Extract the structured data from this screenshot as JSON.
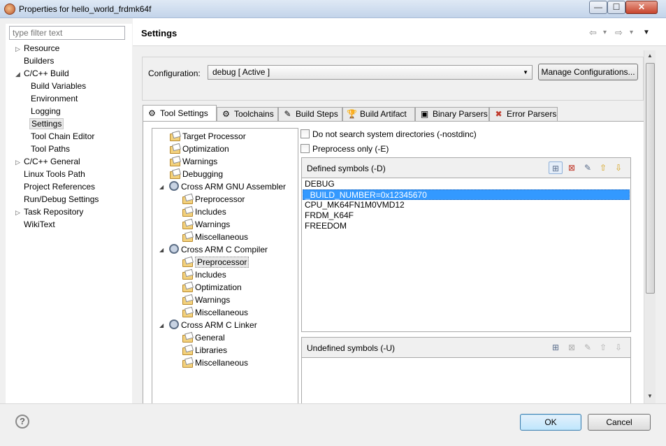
{
  "window": {
    "title": "Properties for hello_world_frdmk64f",
    "min_label": "—",
    "max_label": "☐",
    "close_label": "✕"
  },
  "sidebar": {
    "filter_placeholder": "type filter text",
    "items": [
      {
        "label": "Resource",
        "arrow": "▷"
      },
      {
        "label": "Builders",
        "arrow": ""
      },
      {
        "label": "C/C++ Build",
        "arrow": "◢"
      },
      {
        "label": "Build Variables",
        "arrow": ""
      },
      {
        "label": "Environment",
        "arrow": ""
      },
      {
        "label": "Logging",
        "arrow": ""
      },
      {
        "label": "Settings",
        "arrow": ""
      },
      {
        "label": "Tool Chain Editor",
        "arrow": ""
      },
      {
        "label": "Tool Paths",
        "arrow": ""
      },
      {
        "label": "C/C++ General",
        "arrow": "▷"
      },
      {
        "label": "Linux Tools Path",
        "arrow": ""
      },
      {
        "label": "Project References",
        "arrow": ""
      },
      {
        "label": "Run/Debug Settings",
        "arrow": ""
      },
      {
        "label": "Task Repository",
        "arrow": "▷"
      },
      {
        "label": "WikiText",
        "arrow": ""
      }
    ]
  },
  "header": {
    "title": "Settings",
    "back_icon": "⇦",
    "forward_icon": "⇨",
    "dropdown_icon": "▾",
    "menu_icon": "▼"
  },
  "configuration": {
    "label": "Configuration:",
    "value": "debug  [ Active ]",
    "manage_label": "Manage Configurations..."
  },
  "tabs": [
    {
      "label": "Tool Settings",
      "icon": "⚙"
    },
    {
      "label": "Toolchains",
      "icon": "⚙"
    },
    {
      "label": "Build Steps",
      "icon": "✎"
    },
    {
      "label": "Build Artifact",
      "icon": "🏆"
    },
    {
      "label": "Binary Parsers",
      "icon": "▣"
    },
    {
      "label": "Error Parsers",
      "icon": "✖"
    }
  ],
  "tool_tree": [
    {
      "label": "Target Processor",
      "icon": "folder"
    },
    {
      "label": "Optimization",
      "icon": "folder"
    },
    {
      "label": "Warnings",
      "icon": "folder"
    },
    {
      "label": "Debugging",
      "icon": "folder"
    },
    {
      "label": "Cross ARM GNU Assembler",
      "icon": "gear"
    },
    {
      "label": "Preprocessor",
      "icon": "folder"
    },
    {
      "label": "Includes",
      "icon": "folder"
    },
    {
      "label": "Warnings",
      "icon": "folder"
    },
    {
      "label": "Miscellaneous",
      "icon": "folder"
    },
    {
      "label": "Cross ARM C Compiler",
      "icon": "gear"
    },
    {
      "label": "Preprocessor",
      "icon": "folder"
    },
    {
      "label": "Includes",
      "icon": "folder"
    },
    {
      "label": "Optimization",
      "icon": "folder"
    },
    {
      "label": "Warnings",
      "icon": "folder"
    },
    {
      "label": "Miscellaneous",
      "icon": "folder"
    },
    {
      "label": "Cross ARM C Linker",
      "icon": "gear"
    },
    {
      "label": "General",
      "icon": "folder"
    },
    {
      "label": "Libraries",
      "icon": "folder"
    },
    {
      "label": "Miscellaneous",
      "icon": "folder"
    }
  ],
  "options": {
    "nostdinc_label": "Do not search system directories (-nostdinc)",
    "preprocess_label": "Preprocess only (-E)"
  },
  "defined_symbols": {
    "title": "Defined symbols (-D)",
    "items": [
      "DEBUG",
      "_BUILD_NUMBER=0x12345670",
      "CPU_MK64FN1M0VMD12",
      "FRDM_K64F",
      "FREEDOM"
    ],
    "selected_index": 1
  },
  "undefined_symbols": {
    "title": "Undefined symbols (-U)",
    "items": []
  },
  "tool_icons": {
    "add": "⊞",
    "delete": "⊠",
    "edit": "✎",
    "up": "⇧",
    "down": "⇩"
  },
  "footer": {
    "help_label": "?",
    "ok_label": "OK",
    "cancel_label": "Cancel"
  }
}
